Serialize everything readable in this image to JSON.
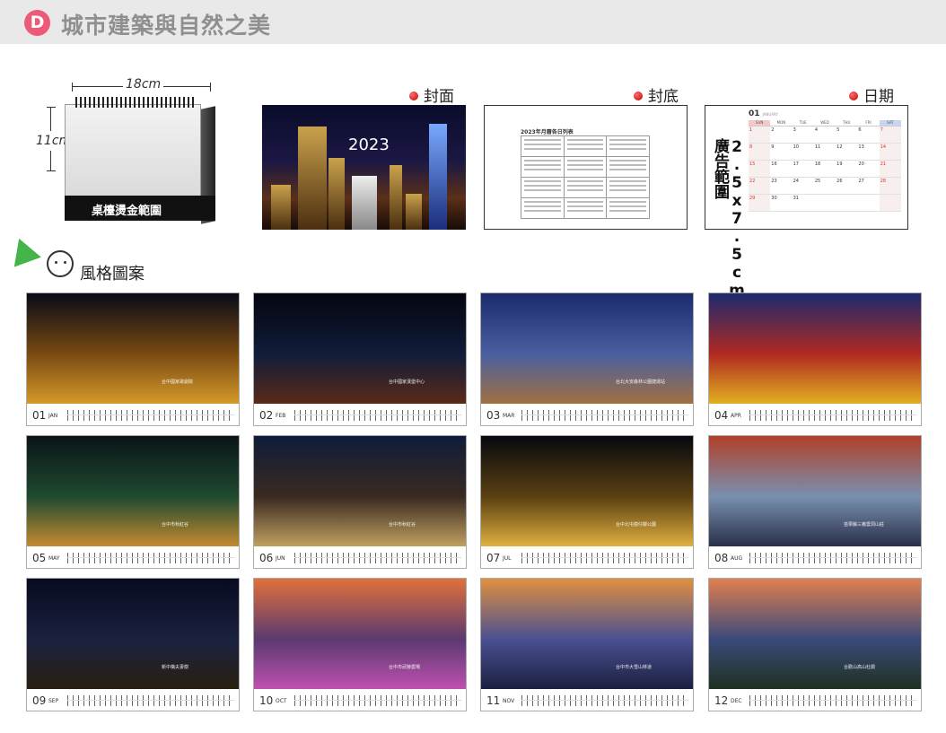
{
  "header": {
    "badge": "D",
    "title": "城市建築與自然之美"
  },
  "desk": {
    "width_label": "18cm",
    "height_label": "11cm",
    "base_label": "桌檯燙金範圍"
  },
  "previews": {
    "cover_label": "封面",
    "back_label": "封底",
    "date_label": "日期",
    "cover_year": "2023",
    "back_title": "2023年月曆各日列表",
    "date_vertical": "2.5x7.5cm廣告範圍",
    "date_month_num": "01",
    "date_month_name": "JANUARY",
    "weekdays": [
      "SUN",
      "MON",
      "TUE",
      "WED",
      "THU",
      "FRI",
      "SAT"
    ],
    "date_cells": [
      "1",
      "2",
      "3",
      "4",
      "5",
      "6",
      "7",
      "8",
      "9",
      "10",
      "11",
      "12",
      "13",
      "14",
      "15",
      "16",
      "17",
      "18",
      "19",
      "20",
      "21",
      "22",
      "23",
      "24",
      "25",
      "26",
      "27",
      "28",
      "29",
      "30",
      "31",
      "",
      "",
      "",
      ""
    ]
  },
  "style_section": {
    "label": "風格圖案"
  },
  "months": [
    {
      "num": "01",
      "abbr": "JAN",
      "cap": "台中國家歌劇院",
      "colors": [
        "#070a18",
        "#7a4a12",
        "#d59a2a"
      ]
    },
    {
      "num": "02",
      "abbr": "FEB",
      "cap": "台中國家漢堡中心",
      "colors": [
        "#04060f",
        "#111c3a",
        "#5a2a18"
      ]
    },
    {
      "num": "03",
      "abbr": "MAR",
      "cap": "台北大安森林公園捷運站",
      "colors": [
        "#1b2a6c",
        "#4a5fa0",
        "#a07040"
      ]
    },
    {
      "num": "04",
      "abbr": "APR",
      "cap": "",
      "colors": [
        "#1c2a70",
        "#b02a20",
        "#e2b020"
      ]
    },
    {
      "num": "05",
      "abbr": "MAY",
      "cap": "台中市秋紅谷",
      "colors": [
        "#0a1418",
        "#1f4a30",
        "#c48a30"
      ]
    },
    {
      "num": "06",
      "abbr": "JUN",
      "cap": "台中市秋紅谷",
      "colors": [
        "#0e1c3a",
        "#3a2a20",
        "#c0a060"
      ]
    },
    {
      "num": "07",
      "abbr": "JUL",
      "cap": "台中北屯樹仔腳公園",
      "colors": [
        "#06080f",
        "#5a4010",
        "#e0b040"
      ]
    },
    {
      "num": "08",
      "abbr": "AUG",
      "cap": "苗栗縣三義雲洞山莊",
      "colors": [
        "#b04028",
        "#7890b0",
        "#2a2f48"
      ]
    },
    {
      "num": "09",
      "abbr": "SEP",
      "cap": "新中橫夫妻樹",
      "colors": [
        "#080a20",
        "#1a2140",
        "#2a2010"
      ]
    },
    {
      "num": "10",
      "abbr": "OCT",
      "cap": "台中市武陵農場",
      "colors": [
        "#e0703a",
        "#5a3a70",
        "#c050b0"
      ]
    },
    {
      "num": "11",
      "abbr": "NOV",
      "cap": "台中市大雪山林道",
      "colors": [
        "#e09040",
        "#4a5090",
        "#1a2040"
      ]
    },
    {
      "num": "12",
      "abbr": "DEC",
      "cap": "合歡山高山杜鵑",
      "colors": [
        "#e08050",
        "#3a4a7a",
        "#1f3020"
      ]
    }
  ]
}
